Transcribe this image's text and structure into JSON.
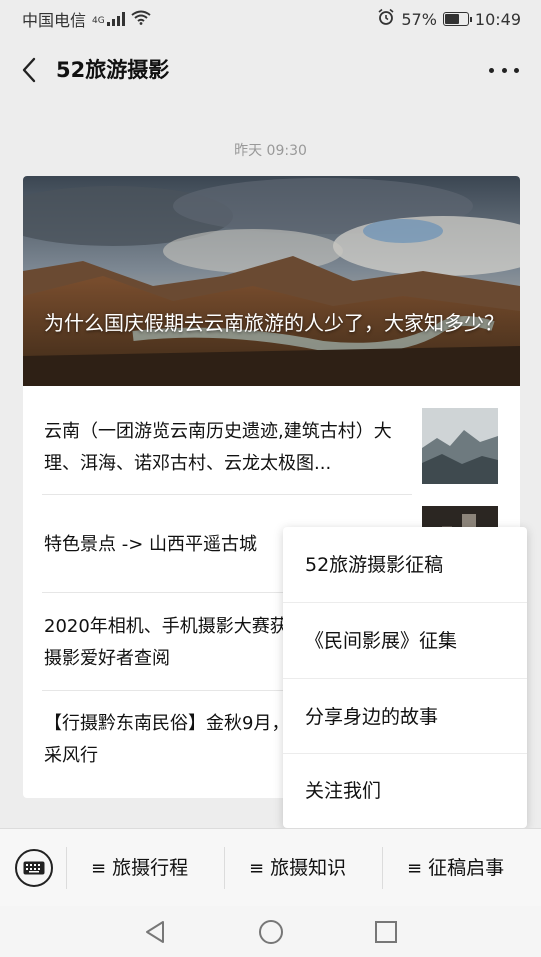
{
  "status_bar": {
    "carrier": "中国电信",
    "network": "4G",
    "signal_icon": "signal-icon",
    "wifi_icon": "wifi-icon",
    "alarm_icon": "alarm-icon",
    "battery_percent": "57%",
    "battery_level": 0.57,
    "time": "10:49"
  },
  "nav": {
    "back_icon": "chevron-left-icon",
    "title": "52旅游摄影",
    "more_icon": "more-icon"
  },
  "chat": {
    "timestamp": "昨天 09:30"
  },
  "article_card": {
    "hero_title": "为什么国庆假期去云南旅游的人少了，大家知多少？",
    "items": [
      {
        "text": "云南（一团游览云南历史遗迹,建筑古村）大理、洱海、诺邓古村、云龙太极图..."
      },
      {
        "text": "特色景点 -> 山西平遥古城"
      },
      {
        "text": "2020年相机、手机摄影大赛获奖作品，便广大摄影爱好者查阅"
      },
      {
        "text": "【行摄黔东南民俗】金秋9月，侗族传歌节7日采风行"
      }
    ]
  },
  "popup_menu": {
    "items": [
      {
        "label": "52旅游摄影征稿"
      },
      {
        "label": "《民间影展》征集"
      },
      {
        "label": "分享身边的故事"
      },
      {
        "label": "关注我们"
      }
    ]
  },
  "bottom_bar": {
    "keyboard_icon": "keyboard-icon",
    "menu_icon_char": "≡",
    "tabs": [
      {
        "label": "旅摄行程"
      },
      {
        "label": "旅摄知识"
      },
      {
        "label": "征稿启事"
      }
    ]
  },
  "system_nav": {
    "back_icon": "triangle-back-icon",
    "home_icon": "circle-home-icon",
    "recents_icon": "square-recents-icon"
  }
}
